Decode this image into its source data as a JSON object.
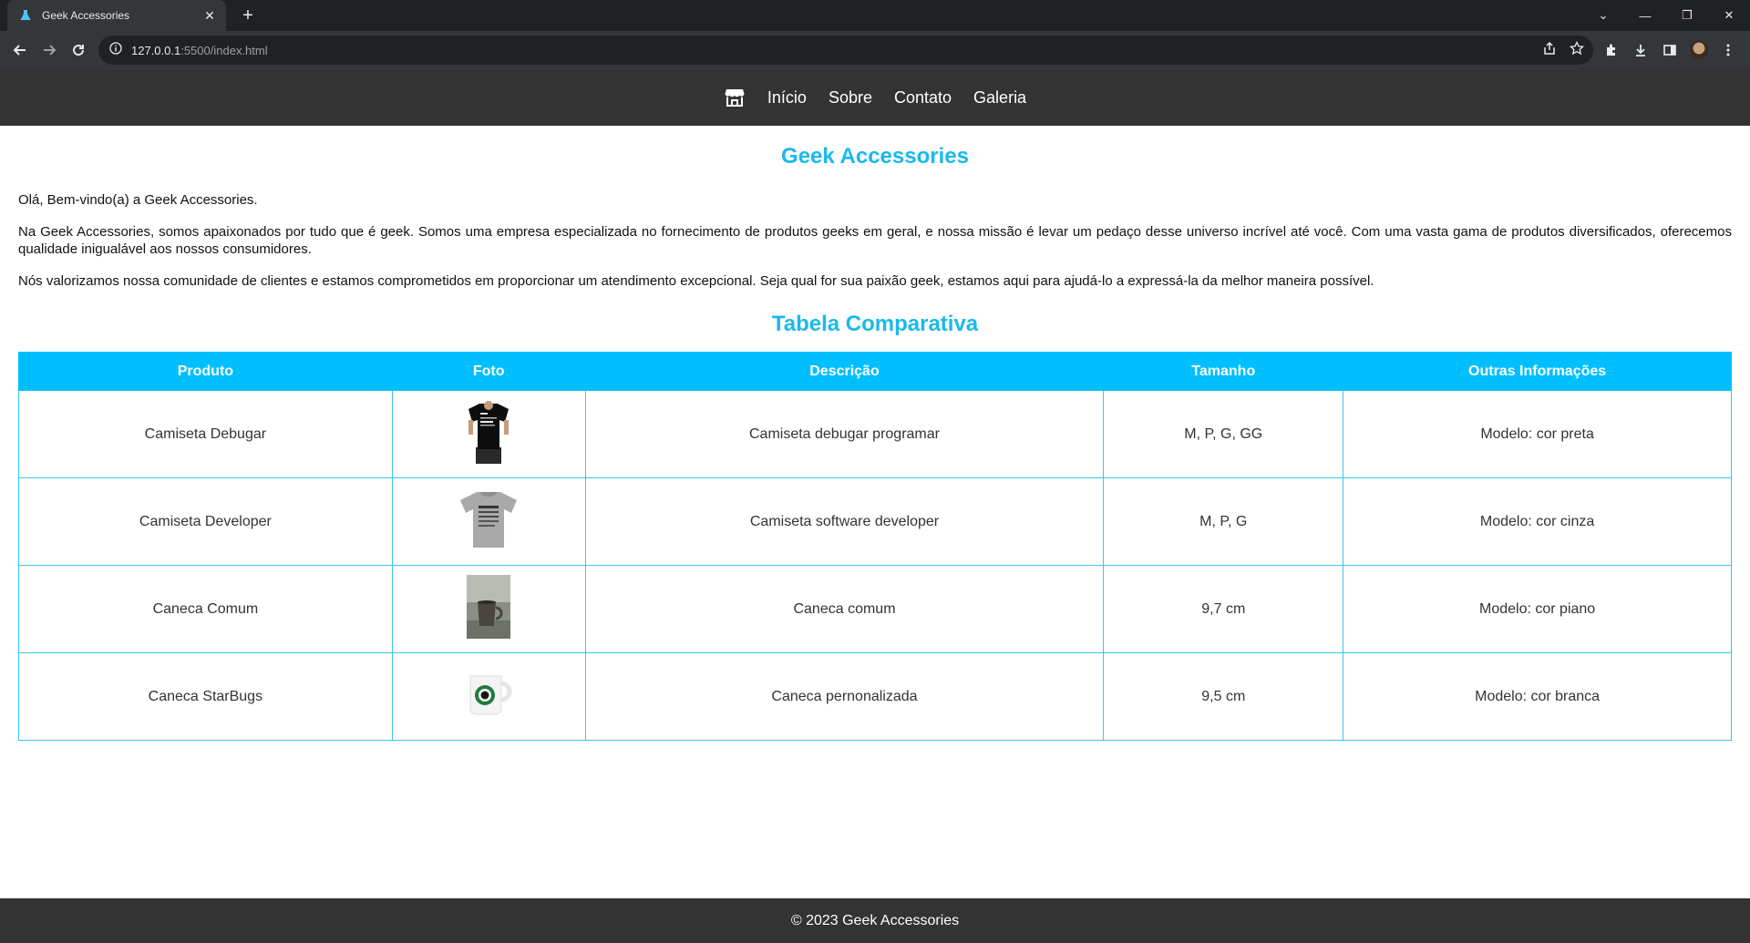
{
  "browser": {
    "tab_title": "Geek Accessories",
    "url_host": "127.0.0.1",
    "url_path": ":5500/index.html"
  },
  "nav": {
    "logo_icon": "store-icon",
    "links": [
      "Início",
      "Sobre",
      "Contato",
      "Galeria"
    ]
  },
  "main": {
    "title": "Geek Accessories",
    "paragraphs": [
      "Olá, Bem-vindo(a) a Geek Accessories.",
      "Na Geek Accessories, somos apaixonados por tudo que é geek. Somos uma empresa especializada no fornecimento de produtos geeks em geral, e nossa missão é levar um pedaço desse universo incrível até você. Com uma vasta gama de produtos diversificados, oferecemos qualidade inigualável aos nossos consumidores.",
      "Nós valorizamos nossa comunidade de clientes e estamos comprometidos em proporcionar um atendimento excepcional. Seja qual for sua paixão geek, estamos aqui para ajudá-lo a expressá-la da melhor maneira possível."
    ],
    "table_title": "Tabela Comparativa"
  },
  "table": {
    "headers": [
      "Produto",
      "Foto",
      "Descrição",
      "Tamanho",
      "Outras Informações"
    ],
    "rows": [
      {
        "produto": "Camiseta Debugar",
        "foto": "black-tshirt",
        "descricao": "Camiseta debugar programar",
        "tamanho": "M, P, G, GG",
        "outras": "Modelo: cor preta"
      },
      {
        "produto": "Camiseta Developer",
        "foto": "gray-tshirt",
        "descricao": "Camiseta software developer",
        "tamanho": "M, P, G",
        "outras": "Modelo: cor cinza"
      },
      {
        "produto": "Caneca Comum",
        "foto": "mug-photo",
        "descricao": "Caneca comum",
        "tamanho": "9,7 cm",
        "outras": "Modelo: cor piano"
      },
      {
        "produto": "Caneca StarBugs",
        "foto": "white-mug",
        "descricao": "Caneca pernonalizada",
        "tamanho": "9,5 cm",
        "outras": "Modelo: cor branca"
      }
    ]
  },
  "footer": {
    "text": "© 2023 Geek Accessories"
  }
}
